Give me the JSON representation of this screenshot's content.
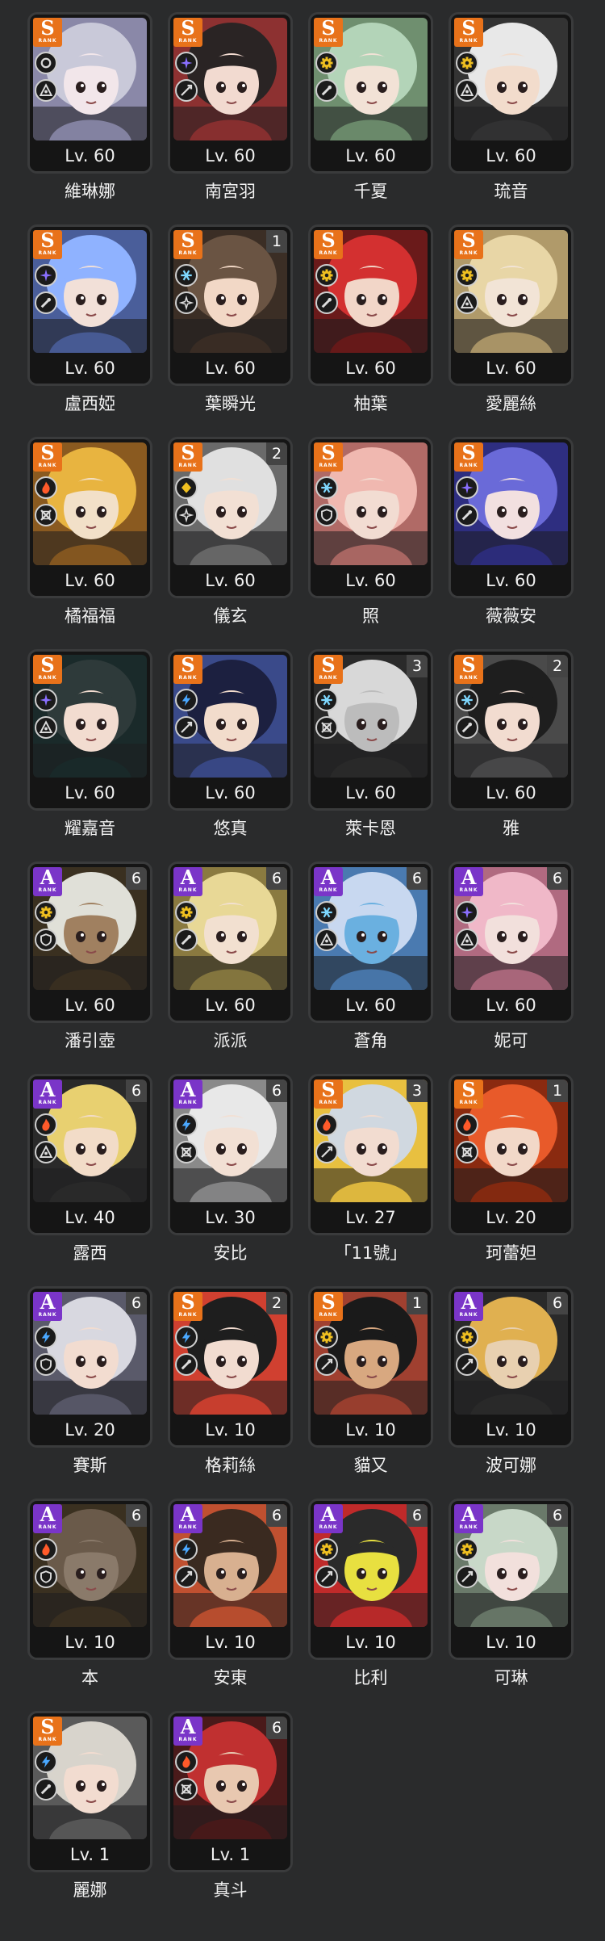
{
  "screen": {
    "title": ""
  },
  "colors": {
    "background": "#2a2b2c",
    "card_border": "#3a3b3c",
    "rank_s": "#e8721a",
    "rank_a": "#7a35c8",
    "attr_ether": "#d9d9d9",
    "attr_electric": "#8a6fff",
    "attr_physical": "#f0c020",
    "attr_ice": "#7ed8ff",
    "attr_fire": "#ff5a2a"
  },
  "rank_sublabel": "RANK",
  "agents": [
    {
      "name": "維琳娜",
      "level": "Lv. 60",
      "rank": "S",
      "mindscape": "",
      "attribute": "ether-ring-icon",
      "specialty": "support-icon",
      "palette": [
        "#c9c9d9",
        "#8a88a8",
        "#f2e6ea"
      ]
    },
    {
      "name": "南宮羽",
      "level": "Lv. 60",
      "rank": "S",
      "mindscape": "",
      "attribute": "electric-spark-icon",
      "specialty": "attack-icon",
      "palette": [
        "#2a2424",
        "#8d3131",
        "#f2dad0"
      ]
    },
    {
      "name": "千夏",
      "level": "Lv. 60",
      "rank": "S",
      "mindscape": "",
      "attribute": "physical-gear-icon",
      "specialty": "anomaly-icon",
      "palette": [
        "#b3d4b8",
        "#6f8f6f",
        "#f2e2d6"
      ]
    },
    {
      "name": "琉音",
      "level": "Lv. 60",
      "rank": "S",
      "mindscape": "",
      "attribute": "physical-gear-icon",
      "specialty": "support-icon",
      "palette": [
        "#e8e8e8",
        "#333333",
        "#f2dccc"
      ]
    },
    {
      "name": "盧西婭",
      "level": "Lv. 60",
      "rank": "S",
      "mindscape": "",
      "attribute": "electric-spark-icon",
      "specialty": "anomaly-icon",
      "palette": [
        "#8fb2ff",
        "#4a5e9a",
        "#f2e0d8"
      ]
    },
    {
      "name": "葉瞬光",
      "level": "Lv. 60",
      "rank": "S",
      "mindscape": "1",
      "attribute": "ice-crystal-icon",
      "specialty": "rupture-icon",
      "palette": [
        "#6a5443",
        "#3b2e25",
        "#f2d8c6"
      ]
    },
    {
      "name": "柚葉",
      "level": "Lv. 60",
      "rank": "S",
      "mindscape": "",
      "attribute": "physical-gear-icon",
      "specialty": "anomaly-icon",
      "palette": [
        "#d33030",
        "#6a1a1a",
        "#f2d6c8"
      ]
    },
    {
      "name": "愛麗絲",
      "level": "Lv. 60",
      "rank": "S",
      "mindscape": "",
      "attribute": "physical-gear-icon",
      "specialty": "support-icon",
      "palette": [
        "#e8d6a6",
        "#b09a6a",
        "#f2e4d6"
      ]
    },
    {
      "name": "橘福福",
      "level": "Lv. 60",
      "rank": "S",
      "mindscape": "",
      "attribute": "fire-flame-icon",
      "specialty": "stun-icon",
      "palette": [
        "#e8b440",
        "#8a5a20",
        "#f2e0c8"
      ]
    },
    {
      "name": "儀玄",
      "level": "Lv. 60",
      "rank": "S",
      "mindscape": "2",
      "attribute": "ether-diamond-icon",
      "specialty": "rupture-icon",
      "palette": [
        "#e0e0e0",
        "#6a6a6a",
        "#f2e0d4"
      ]
    },
    {
      "name": "照",
      "level": "Lv. 60",
      "rank": "S",
      "mindscape": "",
      "attribute": "ice-crystal-icon",
      "specialty": "defense-icon",
      "palette": [
        "#f0b8b0",
        "#b06a66",
        "#f2dcd2"
      ]
    },
    {
      "name": "薇薇安",
      "level": "Lv. 60",
      "rank": "S",
      "mindscape": "",
      "attribute": "electric-spark-icon",
      "specialty": "anomaly-icon",
      "palette": [
        "#6a6ad8",
        "#2e2e80",
        "#f2e0e0"
      ]
    },
    {
      "name": "耀嘉音",
      "level": "Lv. 60",
      "rank": "S",
      "mindscape": "",
      "attribute": "electric-spark-icon",
      "specialty": "support-icon",
      "palette": [
        "#2e3a3a",
        "#1a2a2a",
        "#f2dcd0"
      ]
    },
    {
      "name": "悠真",
      "level": "Lv. 60",
      "rank": "S",
      "mindscape": "",
      "attribute": "electric-bolt-icon",
      "specialty": "attack-icon",
      "palette": [
        "#1c2040",
        "#3a4a8a",
        "#f2dccc"
      ]
    },
    {
      "name": "萊卡恩",
      "level": "Lv. 60",
      "rank": "S",
      "mindscape": "3",
      "attribute": "ice-crystal-icon",
      "specialty": "stun-icon",
      "palette": [
        "#d8d8d8",
        "#2a2a2a",
        "#bcbcbc"
      ]
    },
    {
      "name": "雅",
      "level": "Lv. 60",
      "rank": "S",
      "mindscape": "2",
      "attribute": "ice-crystal-icon",
      "specialty": "anomaly-icon",
      "palette": [
        "#1e1e1e",
        "#4a4a4a",
        "#f2dcd0"
      ]
    },
    {
      "name": "潘引壺",
      "level": "Lv. 60",
      "rank": "A",
      "mindscape": "6",
      "attribute": "physical-gear-icon",
      "specialty": "defense-icon",
      "palette": [
        "#e0e0d8",
        "#3a3020",
        "#a08060"
      ]
    },
    {
      "name": "派派",
      "level": "Lv. 60",
      "rank": "A",
      "mindscape": "6",
      "attribute": "physical-gear-icon",
      "specialty": "anomaly-icon",
      "palette": [
        "#e8d896",
        "#8a7a40",
        "#f2e0d0"
      ]
    },
    {
      "name": "蒼角",
      "level": "Lv. 60",
      "rank": "A",
      "mindscape": "6",
      "attribute": "ice-crystal-icon",
      "specialty": "support-icon",
      "palette": [
        "#c8d8f0",
        "#4a7ab0",
        "#6ab0e0"
      ]
    },
    {
      "name": "妮可",
      "level": "Lv. 60",
      "rank": "A",
      "mindscape": "6",
      "attribute": "electric-spark-icon",
      "specialty": "support-icon",
      "palette": [
        "#f0b8c8",
        "#b06a80",
        "#f2e0dc"
      ]
    },
    {
      "name": "露西",
      "level": "Lv. 40",
      "rank": "A",
      "mindscape": "6",
      "attribute": "fire-flame-icon",
      "specialty": "support-icon",
      "palette": [
        "#e8d070",
        "#2a2a2a",
        "#f2dcc8"
      ]
    },
    {
      "name": "安比",
      "level": "Lv. 30",
      "rank": "A",
      "mindscape": "6",
      "attribute": "electric-bolt-icon",
      "specialty": "stun-icon",
      "palette": [
        "#e8e8e8",
        "#8a8a8a",
        "#f2e0d4"
      ]
    },
    {
      "name": "「11號」",
      "level": "Lv. 27",
      "rank": "S",
      "mindscape": "3",
      "attribute": "fire-flame-icon",
      "specialty": "attack-icon",
      "palette": [
        "#d0d8e0",
        "#e8c040",
        "#f2dcd0"
      ]
    },
    {
      "name": "珂蕾妲",
      "level": "Lv. 20",
      "rank": "S",
      "mindscape": "1",
      "attribute": "fire-flame-icon",
      "specialty": "stun-icon",
      "palette": [
        "#e85a2a",
        "#8a2a10",
        "#f2d8c8"
      ]
    },
    {
      "name": "賽斯",
      "level": "Lv. 20",
      "rank": "A",
      "mindscape": "6",
      "attribute": "electric-bolt-icon",
      "specialty": "defense-icon",
      "palette": [
        "#d8d8e0",
        "#5a5a6a",
        "#f2dcd0"
      ]
    },
    {
      "name": "格莉絲",
      "level": "Lv. 10",
      "rank": "S",
      "mindscape": "2",
      "attribute": "electric-bolt-icon",
      "specialty": "anomaly-icon",
      "palette": [
        "#1e1e1e",
        "#d04030",
        "#f2dcd0"
      ]
    },
    {
      "name": "貓又",
      "level": "Lv. 10",
      "rank": "S",
      "mindscape": "1",
      "attribute": "physical-gear-icon",
      "specialty": "attack-icon",
      "palette": [
        "#1a1a1a",
        "#a04030",
        "#d8a880"
      ]
    },
    {
      "name": "波可娜",
      "level": "Lv. 10",
      "rank": "A",
      "mindscape": "6",
      "attribute": "physical-gear-icon",
      "specialty": "attack-icon",
      "palette": [
        "#e0b050",
        "#2a2a2a",
        "#e8d0b0"
      ]
    },
    {
      "name": "本",
      "level": "Lv. 10",
      "rank": "A",
      "mindscape": "6",
      "attribute": "fire-flame-icon",
      "specialty": "defense-icon",
      "palette": [
        "#6a5a4a",
        "#3a3020",
        "#8a7a6a"
      ]
    },
    {
      "name": "安東",
      "level": "Lv. 10",
      "rank": "A",
      "mindscape": "6",
      "attribute": "electric-bolt-icon",
      "specialty": "attack-icon",
      "palette": [
        "#3a2a20",
        "#c05030",
        "#d8b090"
      ]
    },
    {
      "name": "比利",
      "level": "Lv. 10",
      "rank": "A",
      "mindscape": "6",
      "attribute": "physical-gear-icon",
      "specialty": "attack-icon",
      "palette": [
        "#2a2a2a",
        "#c02a2a",
        "#e8e040"
      ]
    },
    {
      "name": "可琳",
      "level": "Lv. 10",
      "rank": "A",
      "mindscape": "6",
      "attribute": "physical-gear-icon",
      "specialty": "attack-icon",
      "palette": [
        "#c8d8c8",
        "#6a7a6a",
        "#f2e0dc"
      ]
    },
    {
      "name": "麗娜",
      "level": "Lv. 1",
      "rank": "S",
      "mindscape": "",
      "attribute": "electric-bolt-icon",
      "specialty": "anomaly-icon",
      "palette": [
        "#d8d4cc",
        "#5a5a5a",
        "#f2dcd0"
      ]
    },
    {
      "name": "真斗",
      "level": "Lv. 1",
      "rank": "A",
      "mindscape": "6",
      "attribute": "fire-flame-icon",
      "specialty": "stun-icon",
      "palette": [
        "#c03030",
        "#4a1a1a",
        "#e8c8b0"
      ]
    }
  ]
}
